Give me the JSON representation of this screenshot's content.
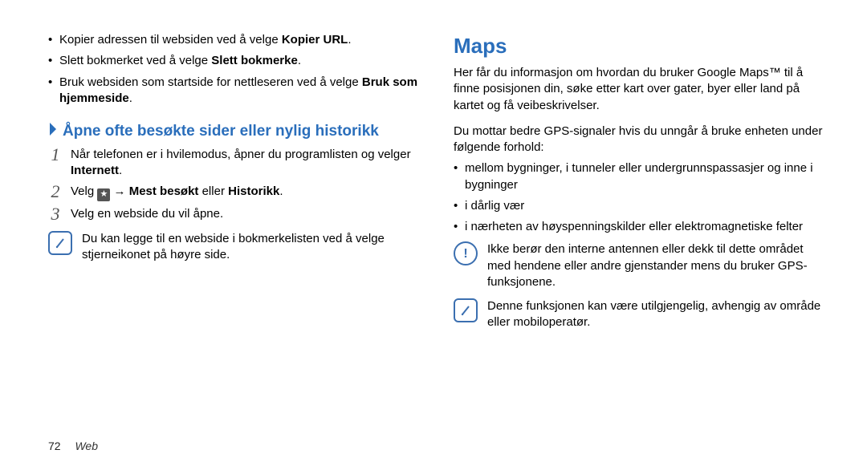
{
  "left": {
    "bullets": [
      {
        "pre": "Kopier adressen til websiden ved å velge ",
        "bold": "Kopier URL",
        "post": "."
      },
      {
        "pre": "Slett bokmerket ved å velge ",
        "bold": "Slett bokmerke",
        "post": "."
      },
      {
        "pre": "Bruk websiden som startside for nettleseren ved å velge ",
        "bold": "Bruk som hjemmeside",
        "post": "."
      }
    ],
    "subhead": "Åpne ofte besøkte sider eller nylig historikk",
    "steps": {
      "s1_pre": "Når telefonen er i hvilemodus, åpner du programlisten og velger ",
      "s1_bold": "Internett",
      "s1_post": ".",
      "s2_pre": "Velg ",
      "s2_arrow": " → ",
      "s2_bold1": "Mest besøkt",
      "s2_mid": " eller ",
      "s2_bold2": "Historikk",
      "s2_post": ".",
      "s3": "Velg en webside du vil åpne."
    },
    "note": "Du kan legge til en webside i bokmerkelisten ved å velge stjerneikonet på høyre side."
  },
  "right": {
    "title": "Maps",
    "intro": "Her får du informasjon om hvordan du bruker Google Maps™ til å finne posisjonen din, søke etter kart over gater, byer eller land på kartet og få veibeskrivelser.",
    "lead": "Du mottar bedre GPS-signaler hvis du unngår å bruke enheten under følgende forhold:",
    "bullets": [
      "mellom bygninger, i tunneler eller undergrunnspassasjer og inne i bygninger",
      "i dårlig vær",
      "i nærheten av høyspenningskilder eller elektromagnetiske felter"
    ],
    "warn": "Ikke berør den interne antennen eller dekk til dette området med hendene eller andre gjenstander mens du bruker GPS-funksjonene.",
    "note": "Denne funksjonen kan være utilgjengelig, avhengig av område eller mobiloperatør."
  },
  "footer": {
    "page": "72",
    "section": "Web"
  }
}
